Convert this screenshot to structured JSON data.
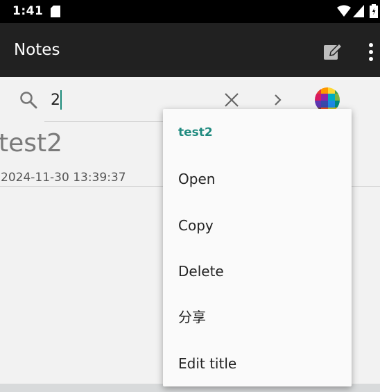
{
  "status_bar": {
    "time": "1:41"
  },
  "app_bar": {
    "title": "Notes"
  },
  "search": {
    "value": "2"
  },
  "note": {
    "title": "test2",
    "date": "2024-11-30  13:39:37"
  },
  "menu": {
    "header": "test2",
    "items": [
      {
        "label": "Open"
      },
      {
        "label": "Copy"
      },
      {
        "label": "Delete"
      },
      {
        "label": "分享"
      },
      {
        "label": "Edit title"
      }
    ]
  },
  "colors": {
    "status_bar": "#000000",
    "app_bar": "#212121",
    "accent": "#1f8a7f",
    "background": "#f2f2f2",
    "menu_background": "#fafafa"
  },
  "icons": [
    "sd-card-icon",
    "wifi-icon",
    "signal-icon",
    "battery-icon",
    "edit-icon",
    "overflow-menu-icon",
    "search-icon",
    "clear-icon",
    "next-icon",
    "color-picker-icon"
  ]
}
